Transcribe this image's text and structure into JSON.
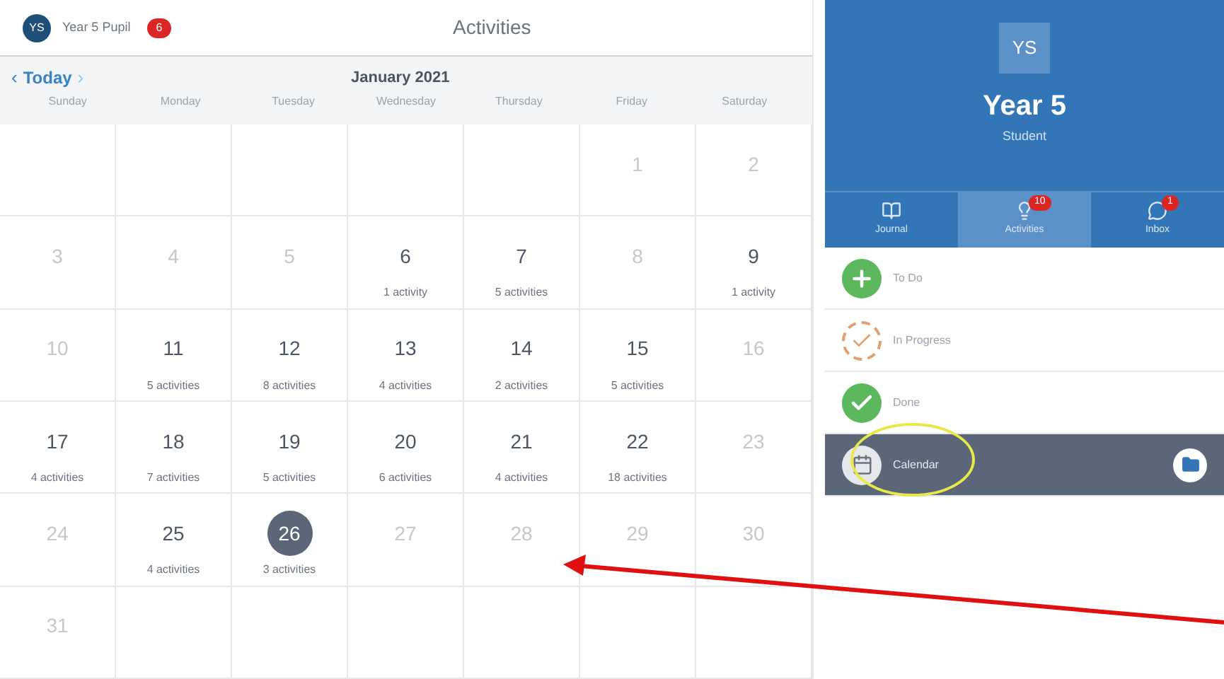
{
  "header": {
    "user_initials": "YS",
    "user_name": "Year 5 Pupil",
    "badge": "6",
    "title": "Activities"
  },
  "calendar": {
    "today_label": "Today",
    "prev": "‹",
    "next": "›",
    "month": "January 2021",
    "weekdays": [
      "Sunday",
      "Monday",
      "Tuesday",
      "Wednesday",
      "Thursday",
      "Friday",
      "Saturday"
    ],
    "days": [
      {
        "day": "1",
        "selected": false
      },
      {
        "day": "2",
        "selected": false
      },
      {
        "day": "3",
        "selected": false
      },
      {
        "day": "4",
        "selected": false
      },
      {
        "day": "5",
        "selected": false
      },
      {
        "day": "6",
        "activities": "1 activity",
        "selected": false
      },
      {
        "day": "7",
        "activities": "5 activities",
        "selected": false
      },
      {
        "day": "8",
        "selected": false
      },
      {
        "day": "9",
        "activities": "1 activity",
        "selected": false
      },
      {
        "day": "10",
        "selected": false
      },
      {
        "day": "11",
        "activities": "5 activities",
        "selected": false
      },
      {
        "day": "12",
        "activities": "8 activities",
        "selected": false
      },
      {
        "day": "13",
        "activities": "4 activities",
        "selected": false
      },
      {
        "day": "14",
        "activities": "2 activities",
        "selected": false
      },
      {
        "day": "15",
        "activities": "5 activities",
        "selected": false
      },
      {
        "day": "16",
        "selected": false
      },
      {
        "day": "17",
        "activities": "4 activities",
        "selected": false
      },
      {
        "day": "18",
        "activities": "7 activities",
        "selected": false
      },
      {
        "day": "19",
        "activities": "5 activities",
        "selected": false
      },
      {
        "day": "20",
        "activities": "6 activities",
        "selected": false
      },
      {
        "day": "21",
        "activities": "4 activities",
        "selected": false
      },
      {
        "day": "22",
        "activities": "18 activities",
        "selected": false
      },
      {
        "day": "23",
        "selected": false
      },
      {
        "day": "24",
        "selected": false
      },
      {
        "day": "25",
        "activities": "4 activities",
        "selected": false
      },
      {
        "day": "26",
        "activities": "3 activities",
        "selected": true
      },
      {
        "day": "27",
        "selected": false
      },
      {
        "day": "28",
        "selected": false
      },
      {
        "day": "29",
        "selected": false
      },
      {
        "day": "30",
        "selected": false
      },
      {
        "day": "31",
        "selected": false
      }
    ]
  },
  "profile": {
    "initials": "YS",
    "name": "Year 5",
    "role": "Student"
  },
  "tabs": [
    {
      "label": "Journal",
      "kind": "journal",
      "selected": false
    },
    {
      "label": "Activities",
      "kind": "activities",
      "badge": "10",
      "selected": true
    },
    {
      "label": "Inbox",
      "kind": "inbox",
      "badge": "1",
      "selected": false
    }
  ],
  "filters": [
    {
      "label": "To Do",
      "kind": "todo",
      "selected": false
    },
    {
      "label": "In Progress",
      "kind": "progress",
      "selected": false
    },
    {
      "label": "Done",
      "kind": "done",
      "selected": false
    },
    {
      "label": "Calendar",
      "kind": "calendar",
      "selected": true
    }
  ]
}
